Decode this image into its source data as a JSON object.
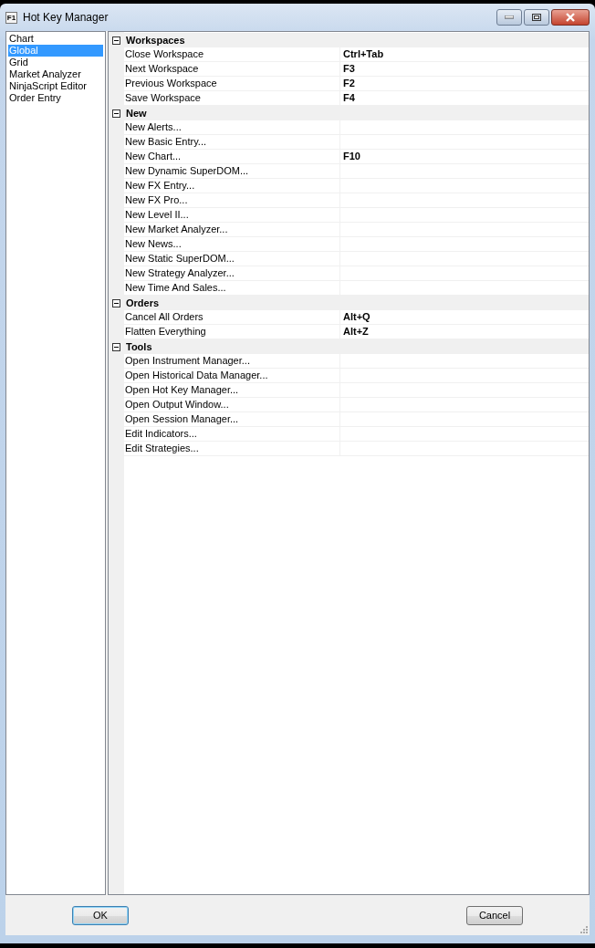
{
  "window": {
    "icon_text": "F1",
    "title": "Hot Key Manager"
  },
  "sidebar": {
    "items": [
      {
        "label": "Chart",
        "selected": false
      },
      {
        "label": "Global",
        "selected": true
      },
      {
        "label": "Grid",
        "selected": false
      },
      {
        "label": "Market Analyzer",
        "selected": false
      },
      {
        "label": "NinjaScript Editor",
        "selected": false
      },
      {
        "label": "Order Entry",
        "selected": false
      }
    ]
  },
  "grid": {
    "categories": [
      {
        "name": "Workspaces",
        "expanded": true,
        "rows": [
          {
            "name": "Close Workspace",
            "key": "Ctrl+Tab"
          },
          {
            "name": "Next Workspace",
            "key": "F3"
          },
          {
            "name": "Previous Workspace",
            "key": "F2"
          },
          {
            "name": "Save Workspace",
            "key": "F4"
          }
        ]
      },
      {
        "name": "New",
        "expanded": true,
        "rows": [
          {
            "name": "New Alerts..."
          },
          {
            "name": "New Basic Entry..."
          },
          {
            "name": "New Chart...",
            "key": "F10"
          },
          {
            "name": "New Dynamic SuperDOM..."
          },
          {
            "name": "New FX Entry..."
          },
          {
            "name": "New FX Pro..."
          },
          {
            "name": "New Level II..."
          },
          {
            "name": "New Market Analyzer..."
          },
          {
            "name": "New News..."
          },
          {
            "name": "New Static SuperDOM..."
          },
          {
            "name": "New Strategy Analyzer..."
          },
          {
            "name": "New Time And Sales..."
          }
        ]
      },
      {
        "name": "Orders",
        "expanded": true,
        "rows": [
          {
            "name": "Cancel All Orders",
            "key": "Alt+Q"
          },
          {
            "name": "Flatten Everything",
            "key": "Alt+Z"
          }
        ]
      },
      {
        "name": "Tools",
        "expanded": true,
        "rows": [
          {
            "name": "Open Instrument Manager..."
          },
          {
            "name": "Open Historical Data Manager..."
          },
          {
            "name": "Open Hot Key Manager..."
          },
          {
            "name": "Open Output Window..."
          },
          {
            "name": "Open Session Manager..."
          },
          {
            "name": "Edit Indicators..."
          },
          {
            "name": "Edit Strategies..."
          }
        ]
      }
    ]
  },
  "buttons": [
    {
      "label": "OK",
      "default": true
    },
    {
      "label": "Cancel",
      "default": false
    }
  ]
}
